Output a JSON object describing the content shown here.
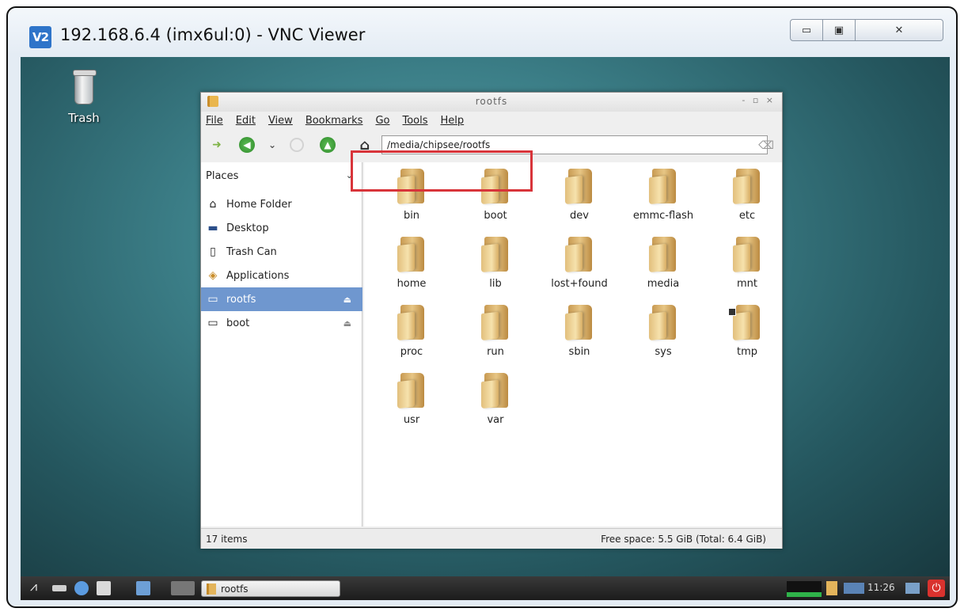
{
  "vnc": {
    "app_icon_text": "V2",
    "title": "192.168.6.4 (imx6ul:0) - VNC Viewer",
    "minimize_glyph": "▭",
    "maximize_glyph": "▣",
    "close_glyph": "✕"
  },
  "desktop": {
    "trash_label": "Trash"
  },
  "file_manager": {
    "title": "rootfs",
    "title_controls": "- ▫ ×",
    "menu": [
      "File",
      "Edit",
      "View",
      "Bookmarks",
      "Go",
      "Tools",
      "Help"
    ],
    "toolbar": {
      "forward_glyph": "➜",
      "back_glyph": "◀",
      "history_glyph": "⌄",
      "up_glyph": "▲",
      "home_glyph": "⌂"
    },
    "location": "/media/chipsee/rootfs",
    "location_clear_glyph": "⌫",
    "sidebar": {
      "header": "Places",
      "chevron": "⌄",
      "items": [
        {
          "label": "Home Folder",
          "icon": "home-icon",
          "glyph": "⌂"
        },
        {
          "label": "Desktop",
          "icon": "desktop-icon",
          "glyph": "▬"
        },
        {
          "label": "Trash Can",
          "icon": "trash-icon",
          "glyph": "▯"
        },
        {
          "label": "Applications",
          "icon": "applications-icon",
          "glyph": "◈"
        },
        {
          "label": "rootfs",
          "icon": "drive-icon",
          "glyph": "▭",
          "eject": "⏏",
          "selected": true
        },
        {
          "label": "boot",
          "icon": "drive-icon",
          "glyph": "▭",
          "eject": "⏏"
        }
      ]
    },
    "folders": [
      "bin",
      "boot",
      "dev",
      "emmc-flash",
      "etc",
      "home",
      "lib",
      "lost+found",
      "media",
      "mnt",
      "proc",
      "run",
      "sbin",
      "sys",
      "tmp",
      "usr",
      "var"
    ],
    "status": {
      "item_count": "17 items",
      "free_space": "Free space: 5.5 GiB (Total: 6.4 GiB)"
    },
    "highlight_color": "#d8343a"
  },
  "taskbar": {
    "menu_glyph": "⩘",
    "task_label": "rootfs",
    "clock": "11:26",
    "power_glyph": "⏻"
  }
}
